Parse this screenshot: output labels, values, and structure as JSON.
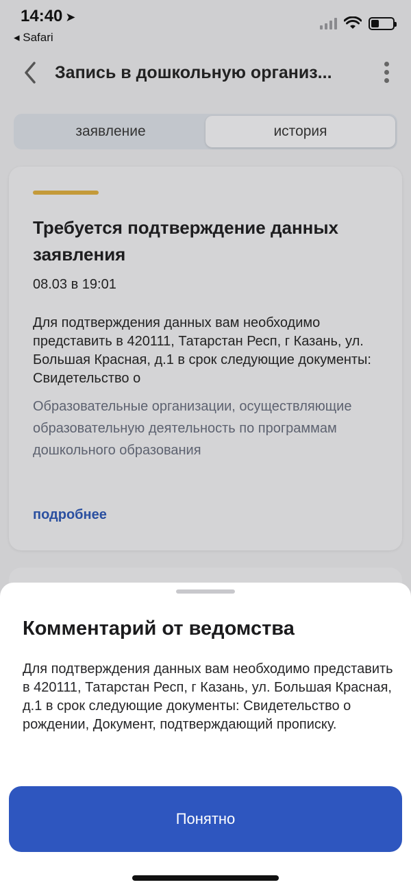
{
  "status_bar": {
    "time": "14:40",
    "back_app": "◂ Safari",
    "location_icon": "location-arrow-icon"
  },
  "header": {
    "title": "Запись в дошкольную организ..."
  },
  "tabs": [
    {
      "label": "заявление",
      "active": false
    },
    {
      "label": "история",
      "active": true
    }
  ],
  "card": {
    "title": "Требуется подтверждение данных заявления",
    "date": "08.03 в 19:01",
    "body": "Для подтверждения данных вам необходимо представить в 420111, Татарстан Респ, г Казань, ул. Большая Красная, д.1 в срок следующие документы: Свидетельство о",
    "organization": "Образовательные организации, осуществляющие образовательную деятельность по программам дошкольного образования",
    "more_link": "подробнее",
    "accent_color": "#c49a3a"
  },
  "sheet": {
    "title": "Комментарий от ведомства",
    "text": "Для подтверждения данных вам необходимо представить в 420111, Татарстан Респ, г Казань, ул. Большая Красная, д.1 в срок следующие документы: Свидетельство о рождении, Документ, подтверждающий прописку.",
    "button_label": "Понятно",
    "button_color": "#2e56bf"
  }
}
